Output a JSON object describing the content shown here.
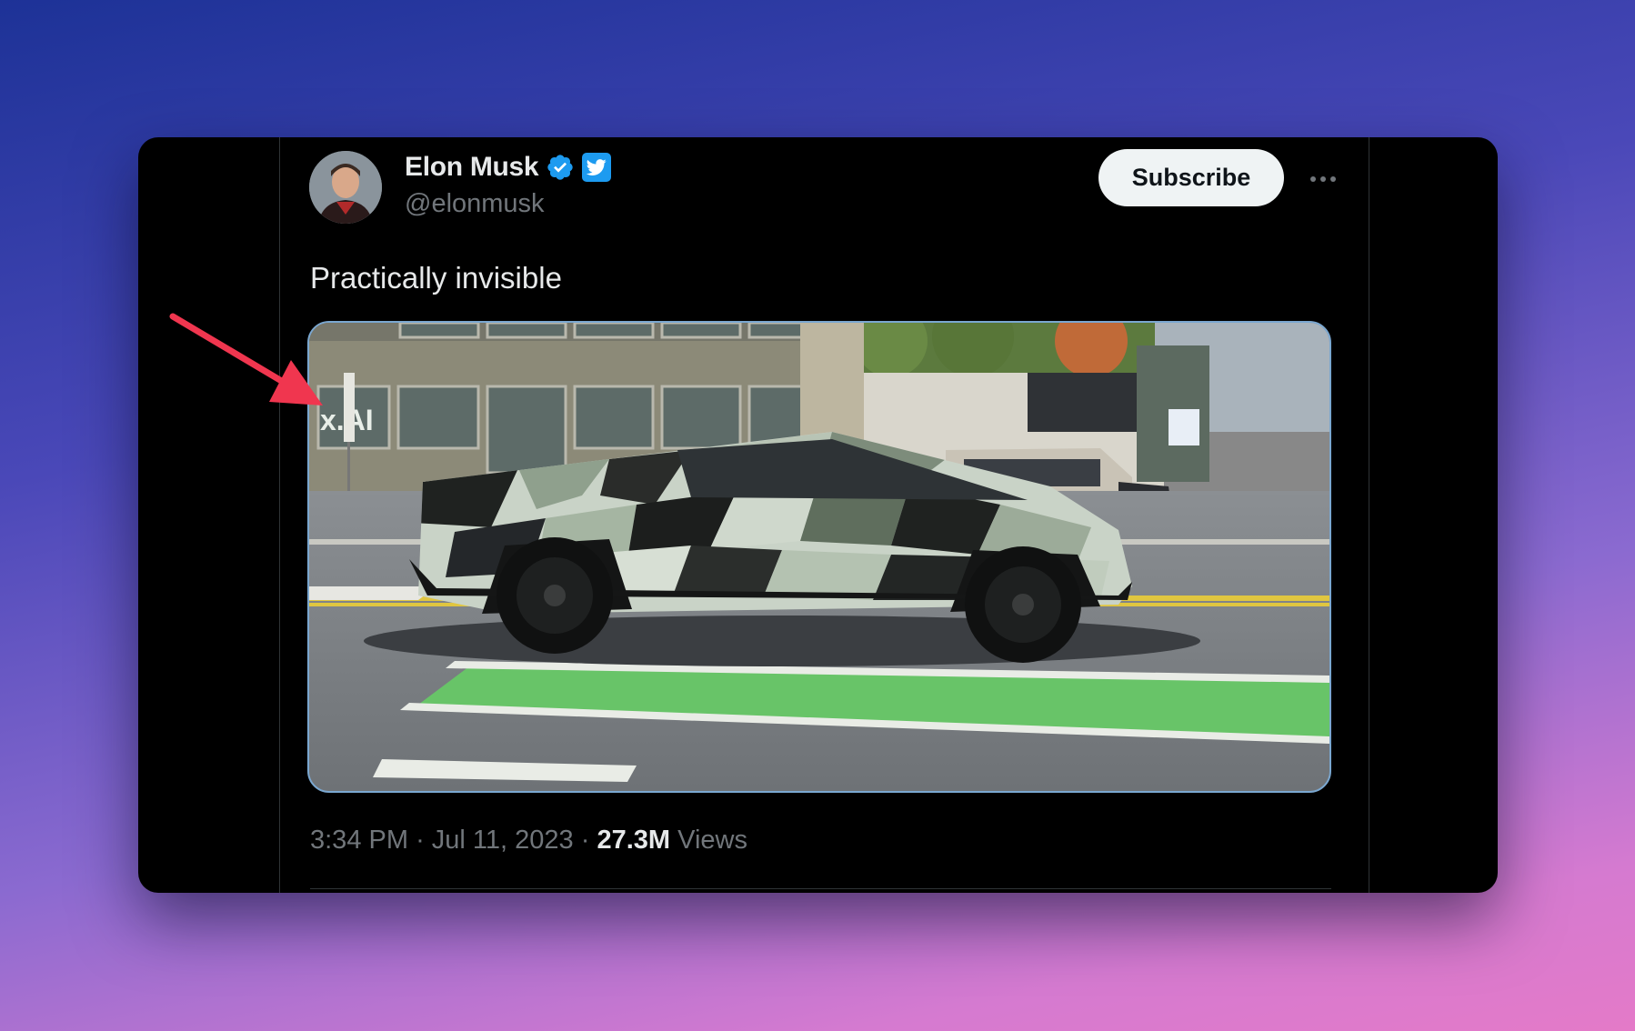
{
  "tweet": {
    "author_name": "Elon Musk",
    "author_handle": "@elonmusk",
    "text": "Practically invisible",
    "subscribe_label": "Subscribe",
    "more_label": "···",
    "time": "3:34 PM",
    "separator": "·",
    "date": "Jul 11, 2023",
    "views_count": "27.3M",
    "views_label": "Views",
    "media_sign_text": "x.AI",
    "media_alt_icons": {
      "verified": "verified-badge-icon",
      "twitter": "twitter-bird-icon",
      "more": "more-dots-icon"
    }
  },
  "annotation": {
    "arrow_icon": "red-arrow-icon",
    "color": "#f0364f"
  }
}
